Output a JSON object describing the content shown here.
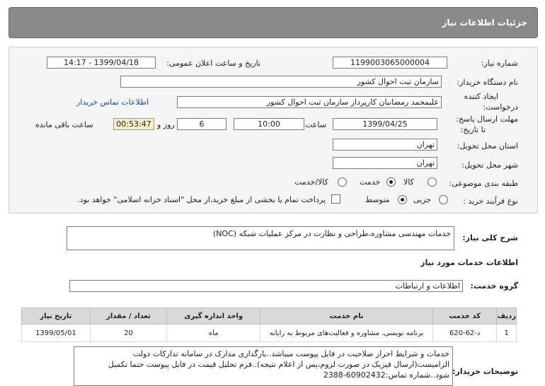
{
  "header": {
    "title": "جزئیات اطلاعات نیاز"
  },
  "need_number": {
    "label": "شماره نیاز:",
    "value": "1199003065000004"
  },
  "announce_datetime": {
    "label": "تاریخ و ساعت اعلان عمومی:",
    "value": "1399/04/18 - 14:17"
  },
  "buyer_org": {
    "label": "نام دستگاه خریدار:",
    "value": "سازمان ثبت احوال کشور"
  },
  "requester": {
    "label_line1": "ایجاد کننده",
    "label_line2": "درخواست:",
    "value": "علیمحمد رمضانیان کارپرداز سازمان ثبت احوال کشور",
    "contact_link": "اطلاعات تماس خریدار"
  },
  "deadline": {
    "label_line1": "مهلت ارسال پاسخ:",
    "label_line2": "تا تاریخ:",
    "date": "1399/04/25",
    "time_label": "ساعت",
    "time": "10:00",
    "days": "6",
    "days_label": "روز و",
    "remaining": "00:53:47",
    "remaining_label": "ساعت باقی مانده"
  },
  "province": {
    "label": "استان محل تحویل:",
    "value": "تهران"
  },
  "city": {
    "label": "شهر محل تحویل:",
    "value": "تهران"
  },
  "category": {
    "label": "طبقه بندی موضوعی:",
    "options": [
      "کالا",
      "خدمت",
      "کالا/خدمت"
    ],
    "selected": "خدمت"
  },
  "purchase_process": {
    "label": "نوع فرآیند خرید :",
    "options": [
      "جزیی",
      "متوسط"
    ],
    "selected": "متوسط",
    "checkbox_label": "پرداخت تمام یا بخشی از مبلغ خرید،از محل \"اسناد خزانه اسلامی\" خواهد بود."
  },
  "general_desc": {
    "label": "شرح کلی نیاز:",
    "value": "خدمات مهندسی مشاوره،طراحی و نظارت در مرکز عملیات شبکه (NOC)"
  },
  "services_info": {
    "title": "اطلاعات خدمات مورد نیاز"
  },
  "service_group": {
    "label": "گروه خدمت:",
    "value": "اطلاعات و ارتباطات"
  },
  "table": {
    "headers": [
      "ردیف",
      "کد خدمت",
      "نام خدمت",
      "واحد اندازه گیری",
      "تعداد / مقدار",
      "تاریخ نیاز"
    ],
    "rows": [
      [
        "1",
        "د-62-620",
        "برنامه نویسی، مشاوره و فعالیت‌های مربوط به رایانه",
        "ماه",
        "20",
        "1399/05/01"
      ]
    ]
  },
  "buyer_notes": {
    "label": "توضیحات خریدار:",
    "lines": [
      "خدمات و شرایط احراز صلاحیت در فایل پیوست میباشد..بارگذاری مدارک در سامانه تدارکات دولت",
      "الزامیست(ارسال فیزیک در صورت لزوم،پس از اعلام نتیجه)..فرم تحلیل قیمت در فایل پیوست حتما تکمیل",
      "شود..شماره تماس:60902432-2388"
    ]
  }
}
